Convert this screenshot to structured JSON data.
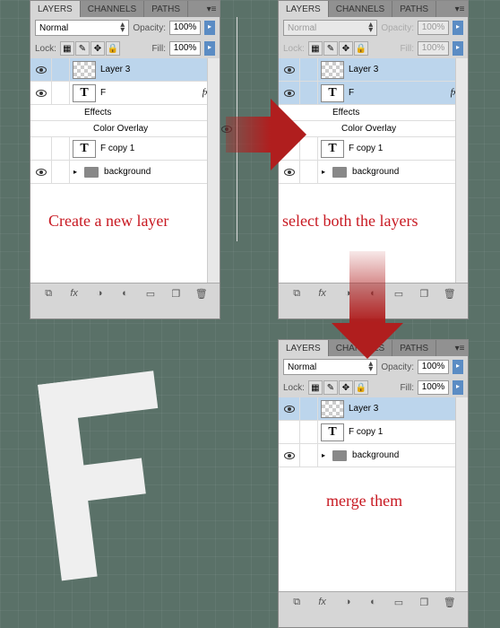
{
  "tabs": {
    "layers": "LAYERS",
    "channels": "CHANNELS",
    "paths": "PATHS"
  },
  "blend_mode": "Normal",
  "opacity_label": "Opacity:",
  "opacity_value": "100%",
  "lock_label": "Lock:",
  "fill_label": "Fill:",
  "fill_value": "100%",
  "fx": "fx",
  "text_glyph": "T",
  "panel1": {
    "layers": [
      {
        "name": "Layer 3"
      },
      {
        "name": "F"
      },
      {
        "name": "F copy 1"
      },
      {
        "name": "background"
      }
    ],
    "effects": "Effects",
    "color_overlay": "Color Overlay"
  },
  "panel2": {
    "layers": [
      {
        "name": "Layer 3"
      },
      {
        "name": "F"
      },
      {
        "name": "F copy 1"
      },
      {
        "name": "background"
      }
    ],
    "effects": "Effects",
    "color_overlay": "Color Overlay"
  },
  "panel3": {
    "layers": [
      {
        "name": "Layer 3"
      },
      {
        "name": "F copy 1"
      },
      {
        "name": "background"
      }
    ]
  },
  "annotations": {
    "create": "Create a new layer",
    "select": "select both the layers",
    "merge": "merge them"
  }
}
